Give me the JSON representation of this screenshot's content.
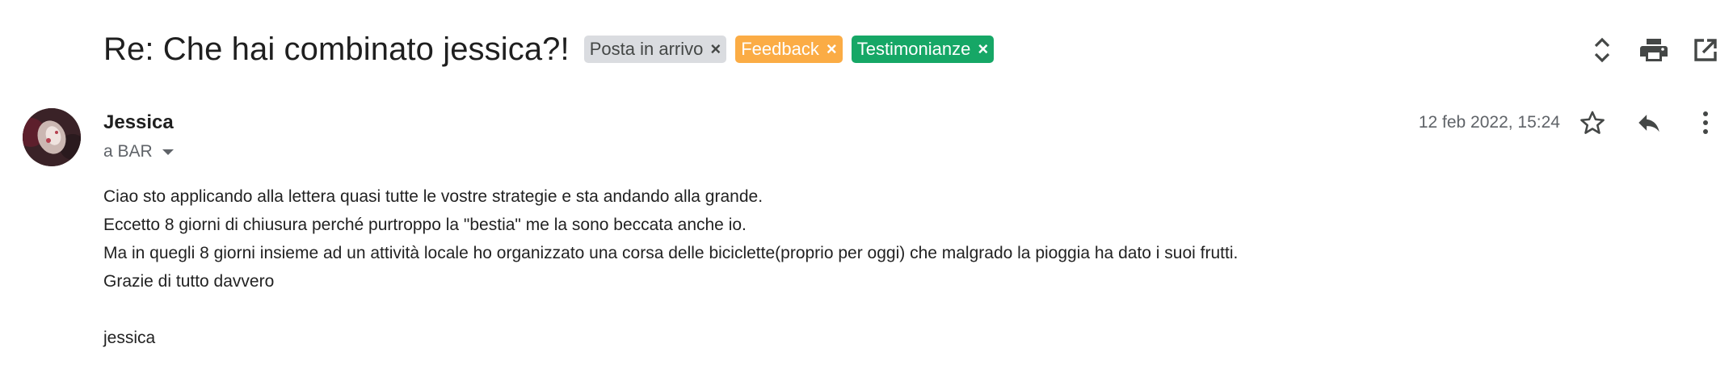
{
  "subject": {
    "title": "Re: Che hai combinato jessica?!",
    "labels": [
      {
        "text": "Posta in arrivo",
        "close": "×",
        "color": "#dadce0"
      },
      {
        "text": "Feedback",
        "close": "×",
        "color": "#fbac45"
      },
      {
        "text": "Testimonianze",
        "close": "×",
        "color": "#16a766"
      }
    ],
    "actions": [
      {
        "icon": "expand-all-icon"
      },
      {
        "icon": "print-icon"
      },
      {
        "icon": "open-in-new-window-icon"
      }
    ]
  },
  "message": {
    "sender": "Jessica",
    "recipient": "a BAR",
    "date": "12 feb 2022, 15:24",
    "actions": [
      {
        "icon": "star-icon"
      },
      {
        "icon": "reply-icon"
      },
      {
        "icon": "more-vert-icon"
      }
    ],
    "body": [
      "Ciao sto applicando alla lettera quasi tutte le vostre strategie e sta andando alla grande.",
      "Eccetto 8 giorni di chiusura perché purtroppo la \"bestia\" me la sono beccata anche io.",
      "Ma in quegli 8 giorni insieme ad un attività locale ho organizzato una corsa delle biciclette(proprio per oggi) che malgrado la pioggia ha dato i suoi frutti.",
      "Grazie di tutto davvero",
      "jessica"
    ]
  },
  "colors": {
    "text_primary": "#1f1f1f",
    "text_secondary": "#5f6368",
    "icon": "#444746"
  }
}
